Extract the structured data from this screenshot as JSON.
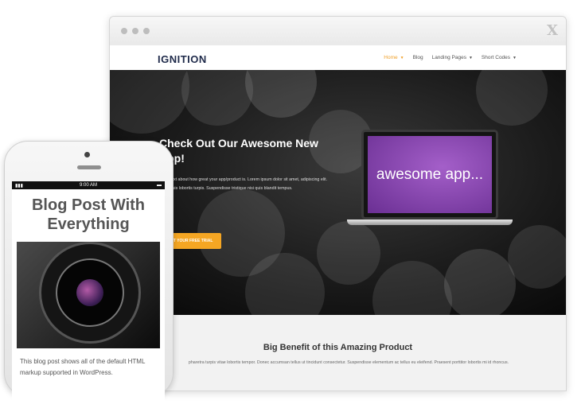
{
  "desktop": {
    "logo": "IGNITION",
    "nav": [
      {
        "label": "Home",
        "active": true
      },
      {
        "label": "Blog",
        "active": false
      },
      {
        "label": "Landing Pages",
        "active": false
      },
      {
        "label": "Short Codes",
        "active": false
      }
    ],
    "hero": {
      "title": "Check Out Our Awesome New App!",
      "text": "more text about how great your app/product is. Lorem ipsum dolor sit amet, adipiscing elit. Nulla quis lobortis turpis. Suspendisse tristique nisi quis blandit tempus.",
      "cta": "GET YOUR FREE TRIAL",
      "laptop_text": "awesome app..."
    },
    "benefit": {
      "title": "Big Benefit of this Amazing Product",
      "text": "pharetra turpis vitae lobortis tempor. Donec accumsan tellus ut tincidunt consectetur. Suspendisse elementum ac tellus eu eleifend. Praesent porttitor lobortis mi id rhoncus."
    },
    "colors": {
      "accent": "#f5a623",
      "laptop_screen": "#8a44b4"
    }
  },
  "phone": {
    "time": "9:00 AM",
    "post_title": "Blog Post With Everything",
    "post_text": "This blog post shows all of the default HTML markup supported in WordPress."
  }
}
